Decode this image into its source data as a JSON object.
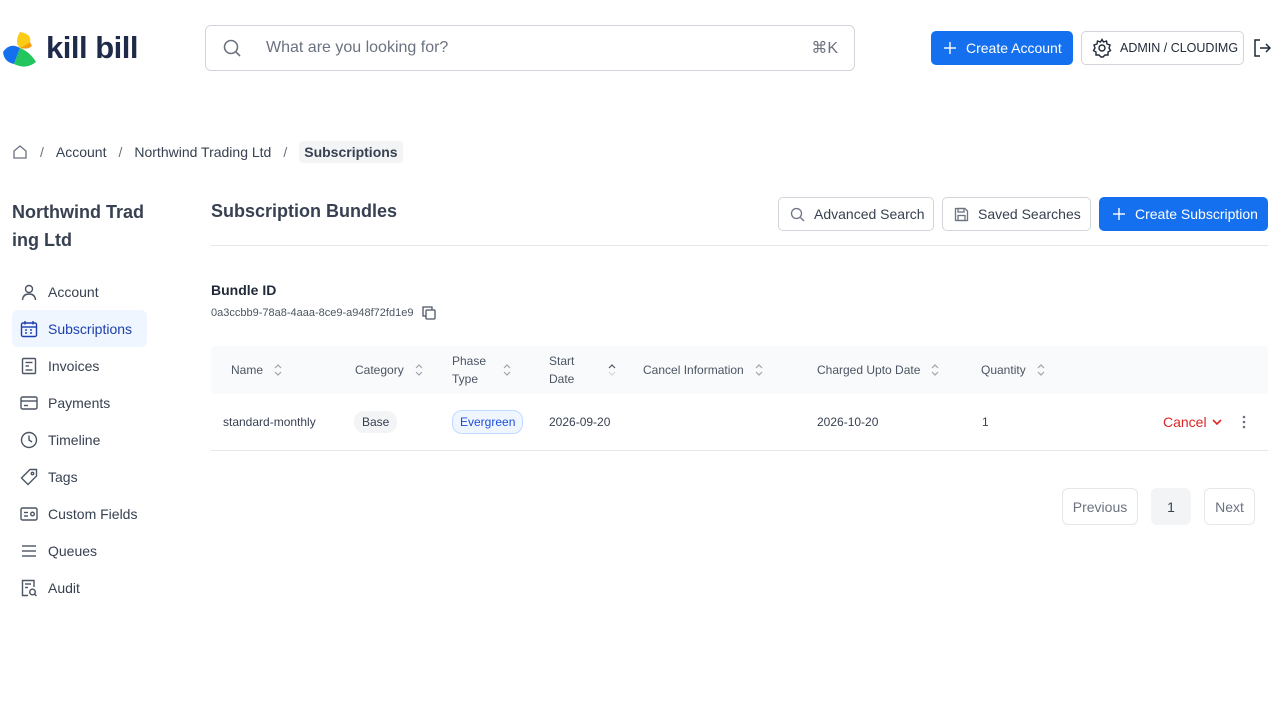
{
  "brand": {
    "name": "kill bill"
  },
  "search": {
    "placeholder": "What are you looking for?",
    "shortcut": "⌘K"
  },
  "header": {
    "create_account_label": "Create Account",
    "tenant_label": "ADMIN / CLOUDIMG"
  },
  "breadcrumb": {
    "items": [
      "Account",
      "Northwind Trading Ltd"
    ],
    "current": "Subscriptions"
  },
  "sidebar": {
    "account_name": "Northwind Trad ing Ltd",
    "items": [
      {
        "label": "Account",
        "icon": "user-icon"
      },
      {
        "label": "Subscriptions",
        "icon": "calendar-icon",
        "active": true
      },
      {
        "label": "Invoices",
        "icon": "invoice-icon"
      },
      {
        "label": "Payments",
        "icon": "credit-card-icon"
      },
      {
        "label": "Timeline",
        "icon": "clock-icon"
      },
      {
        "label": "Tags",
        "icon": "tag-icon"
      },
      {
        "label": "Custom Fields",
        "icon": "custom-fields-icon"
      },
      {
        "label": "Queues",
        "icon": "queue-icon"
      },
      {
        "label": "Audit",
        "icon": "audit-icon"
      }
    ]
  },
  "main": {
    "title": "Subscription Bundles",
    "advanced_search_label": "Advanced Search",
    "saved_searches_label": "Saved Searches",
    "create_subscription_label": "Create Subscription",
    "bundle_label": "Bundle ID",
    "bundle_id": "0a3ccbb9-78a8-4aaa-8ce9-a948f72fd1e9"
  },
  "table": {
    "columns": [
      "Name",
      "Category",
      "Phase Type",
      "Start Date",
      "Cancel Information",
      "Charged Upto Date",
      "Quantity"
    ],
    "rows": [
      {
        "name": "standard-monthly",
        "category": "Base",
        "phase_type": "Evergreen",
        "start_date": "2026-09-20",
        "cancel_info": "",
        "charged_upto": "2026-10-20",
        "quantity": "1",
        "action": "Cancel"
      }
    ]
  },
  "pagination": {
    "prev": "Previous",
    "page": "1",
    "next": "Next"
  },
  "colors": {
    "primary": "#1570ef",
    "danger": "#dc2626",
    "active_bg": "#eff6ff"
  }
}
